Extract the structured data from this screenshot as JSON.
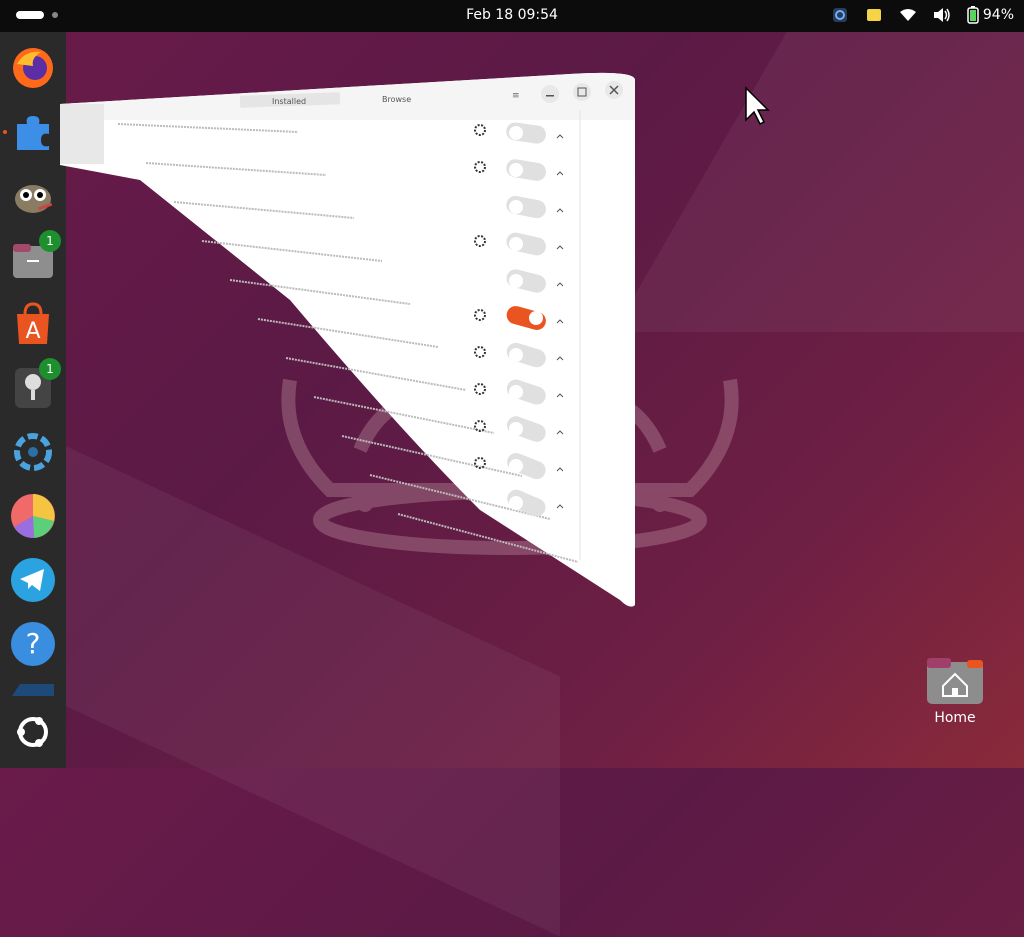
{
  "topbar": {
    "datetime": "Feb 18  09:54",
    "battery": "94%",
    "icons": [
      "screen-share-icon",
      "sticky-notes-icon",
      "wifi-icon",
      "volume-icon",
      "battery-icon"
    ]
  },
  "dock": {
    "items": [
      {
        "name": "firefox",
        "badge": ""
      },
      {
        "name": "extension-manager",
        "badge": "",
        "running": true
      },
      {
        "name": "gimp",
        "badge": ""
      },
      {
        "name": "files",
        "badge": "1"
      },
      {
        "name": "app-center",
        "badge": ""
      },
      {
        "name": "sound-recorder",
        "badge": "1"
      },
      {
        "name": "shotwell",
        "badge": ""
      },
      {
        "name": "disk-usage",
        "badge": ""
      },
      {
        "name": "telegram",
        "badge": ""
      },
      {
        "name": "help",
        "badge": ""
      },
      {
        "name": "terminal",
        "badge": ""
      },
      {
        "name": "show-apps",
        "badge": ""
      }
    ]
  },
  "window": {
    "tabs": [
      "Installed",
      "Browse"
    ],
    "toggles": [
      false,
      false,
      false,
      false,
      false,
      true,
      false,
      false,
      false,
      false,
      false
    ]
  },
  "desktop": {
    "home_label": "Home"
  },
  "colors": {
    "accent": "#e95420",
    "badge": "#1d8f2e",
    "panel": "#0c0c0c",
    "dock": "#2a2a2a"
  }
}
